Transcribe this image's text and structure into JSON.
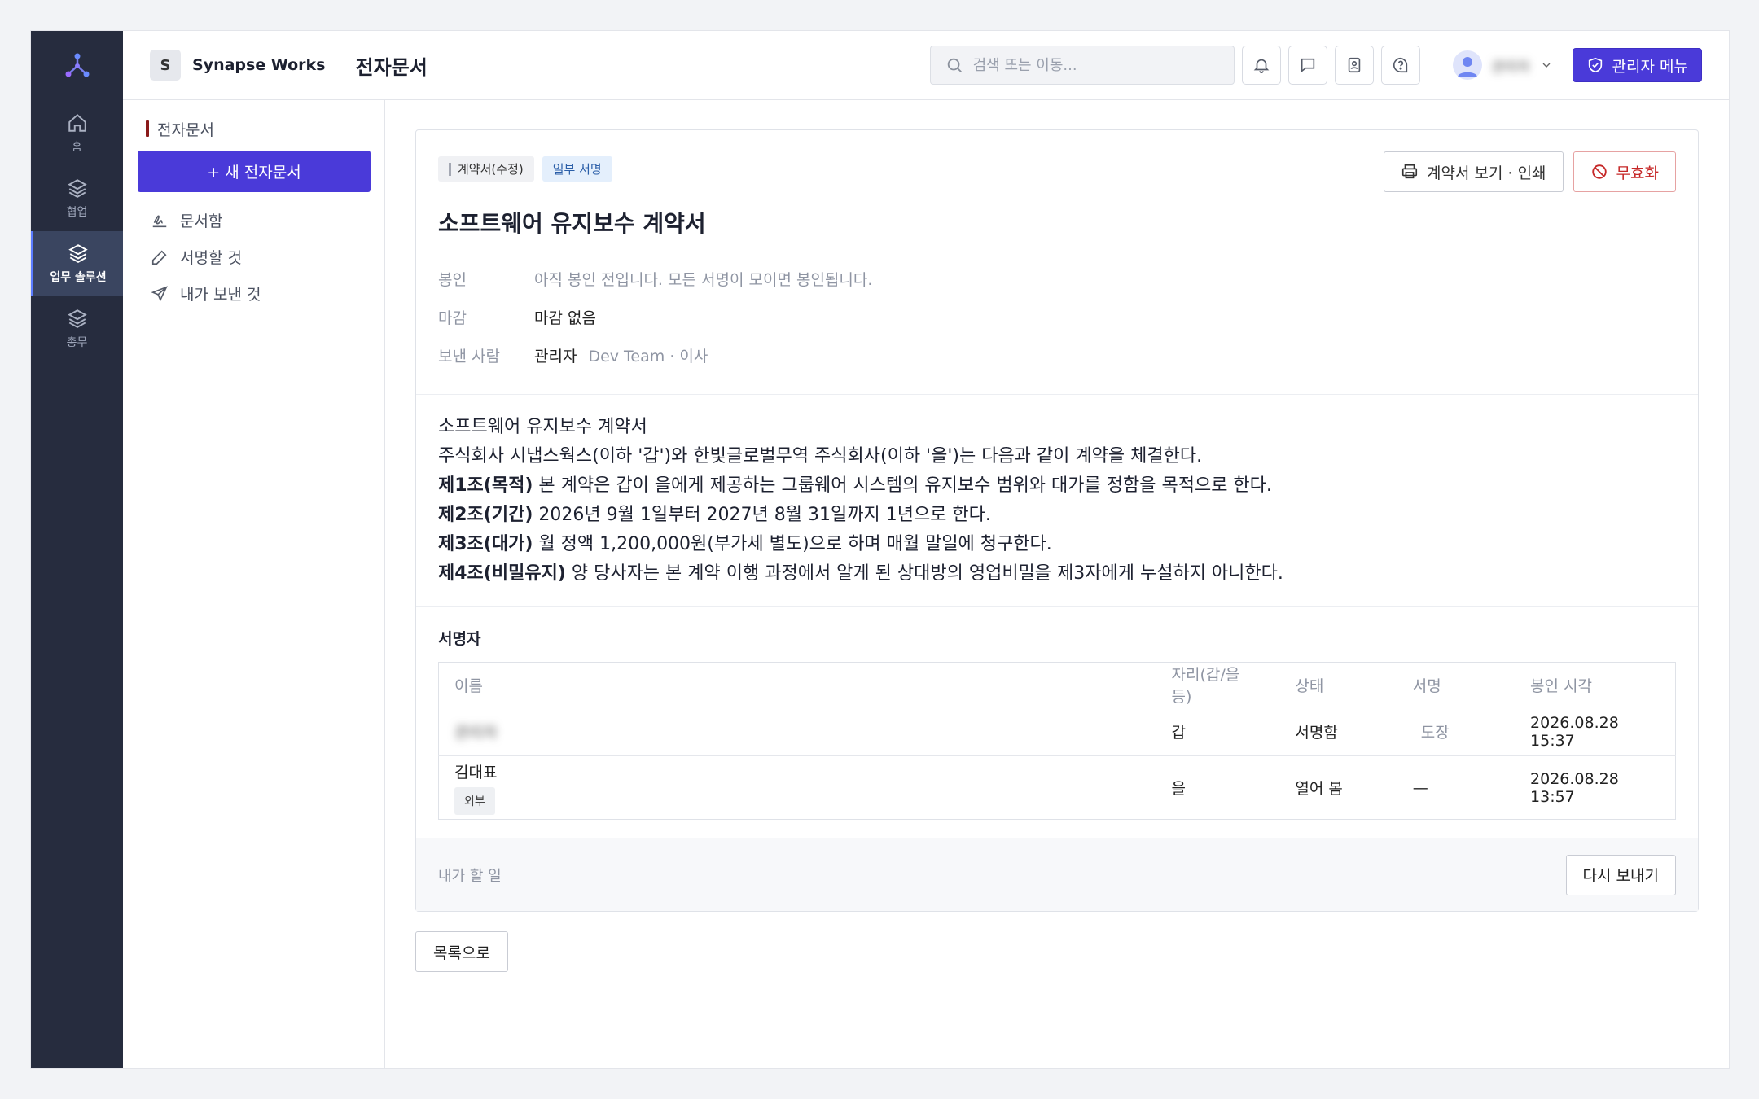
{
  "colors": {
    "accent": "#4a3ad9",
    "rail": "#262c3e",
    "danger": "#c62828",
    "tag_blue": "#2a5ea8"
  },
  "rail": {
    "logo_icon": "network-logo-icon",
    "items": [
      {
        "label": "홈",
        "icon": "home-icon",
        "active": false
      },
      {
        "label": "협업",
        "icon": "layers-icon",
        "active": false
      },
      {
        "label": "업무 솔루션",
        "icon": "layers-icon",
        "active": true
      },
      {
        "label": "총무",
        "icon": "layers-icon",
        "active": false
      }
    ]
  },
  "topbar": {
    "org_initial": "S",
    "org_name": "Synapse Works",
    "page_title": "전자문서",
    "search_placeholder": "검색 또는 이동...",
    "icons": [
      "bell-icon",
      "chat-icon",
      "contacts-icon",
      "help-icon"
    ],
    "user_name": "관리자",
    "admin_label": "관리자 메뉴"
  },
  "sidebar": {
    "section": "전자문서",
    "new_button": "+ 새 전자문서",
    "links": [
      {
        "label": "문서함",
        "icon": "signature-icon"
      },
      {
        "label": "서명할 것",
        "icon": "pen-icon"
      },
      {
        "label": "내가 보낸 것",
        "icon": "send-icon"
      }
    ]
  },
  "document": {
    "tags": {
      "type": "계약서(수정)",
      "status": "일부 서명"
    },
    "actions": {
      "view_print": "계약서 보기 · 인쇄",
      "void": "무효화"
    },
    "title": "소프트웨어 유지보수 계약서",
    "meta": {
      "seal_label": "봉인",
      "seal_value": "아직 봉인 전입니다. 모든 서명이 모이면 봉인됩니다.",
      "deadline_label": "마감",
      "deadline_value": "마감 없음",
      "sender_label": "보낸 사람",
      "sender_name": "관리자",
      "sender_org": "Dev Team · 이사"
    },
    "body": {
      "line1": "소프트웨어 유지보수 계약서",
      "line2": "주식회사 시냅스웍스(이하 '갑')와 한빛글로벌무역 주식회사(이하 '을')는 다음과 같이 계약을 체결한다.",
      "articles": [
        {
          "head": "제1조(목적)",
          "text": " 본 계약은 갑이 을에게 제공하는 그룹웨어 시스템의 유지보수 범위와 대가를 정함을 목적으로 한다."
        },
        {
          "head": "제2조(기간)",
          "text": " 2026년 9월 1일부터 2027년 8월 31일까지 1년으로 한다."
        },
        {
          "head": "제3조(대가)",
          "text": " 월 정액 1,200,000원(부가세 별도)으로 하며 매월 말일에 청구한다."
        },
        {
          "head": "제4조(비밀유지)",
          "text": " 양 당사자는 본 계약 이행 과정에서 알게 된 상대방의 영업비밀을 제3자에게 누설하지 아니한다."
        }
      ]
    },
    "signers": {
      "title": "서명자",
      "columns": [
        "이름",
        "자리(갑/을 등)",
        "상태",
        "서명",
        "봉인 시각"
      ],
      "rows": [
        {
          "name": "관리자",
          "badge": "",
          "party": "갑",
          "status": "서명함",
          "signature": "도장",
          "sealed_at": "2026.08.28 15:37"
        },
        {
          "name": "김대표",
          "badge": "외부",
          "party": "을",
          "status": "열어 봄",
          "signature": "—",
          "sealed_at": "2026.08.28 13:57"
        }
      ]
    },
    "footer": {
      "label": "내가 할 일",
      "resend": "다시 보내기"
    }
  },
  "back_button": "목록으로"
}
